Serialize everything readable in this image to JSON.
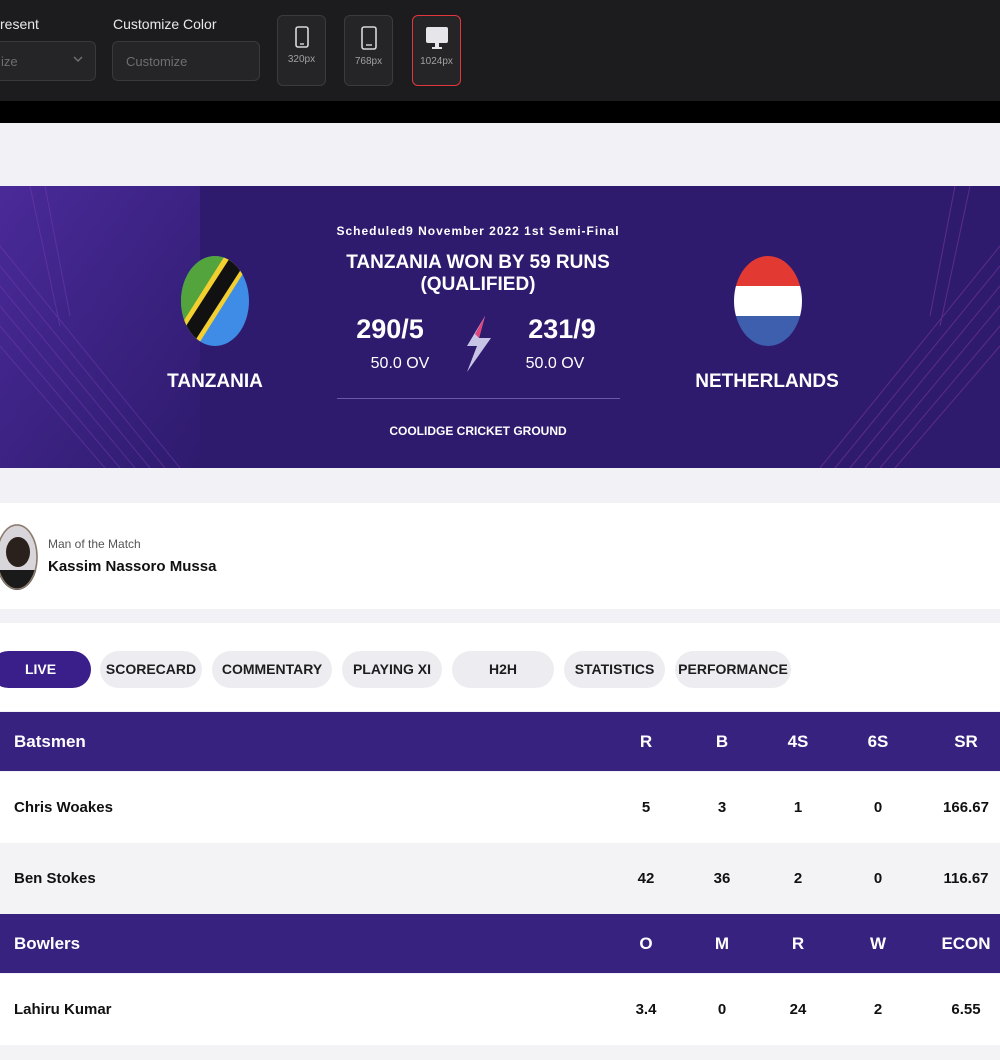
{
  "toolbar": {
    "preset_label": "resent",
    "preset_value": "ize",
    "color_label": "Customize Color",
    "color_placeholder": "Customize",
    "devices": [
      {
        "label": "320px",
        "icon": "phone-icon"
      },
      {
        "label": "768px",
        "icon": "tablet-icon"
      },
      {
        "label": "1024px",
        "icon": "desktop-icon",
        "active": true
      }
    ],
    "accent": "#e2363c"
  },
  "match": {
    "status_line": "Scheduled9 November 2022  1st Semi-Final",
    "result": "TANZANIA WON BY 59 RUNS (QUALIFIED)",
    "venue": "COOLIDGE CRICKET GROUND",
    "team1": {
      "name": "TANZANIA",
      "score": "290/5",
      "overs": "50.0 OV"
    },
    "team2": {
      "name": "NETHERLANDS",
      "score": "231/9",
      "overs": "50.0 OV"
    },
    "brand_color": "#2e1b6e"
  },
  "motm": {
    "label": "Man of the Match",
    "player": "Kassim Nassoro Mussa"
  },
  "tabs": [
    "LIVE",
    "SCORECARD",
    "COMMENTARY",
    "PLAYING XI",
    "H2H",
    "STATISTICS",
    "PERFORMANCE"
  ],
  "batting": {
    "title": "Batsmen",
    "columns": [
      "R",
      "B",
      "4S",
      "6S",
      "SR"
    ],
    "rows": [
      {
        "name": "Chris Woakes",
        "values": [
          "5",
          "3",
          "1",
          "0",
          "166.67"
        ]
      },
      {
        "name": "Ben Stokes",
        "values": [
          "42",
          "36",
          "2",
          "0",
          "116.67"
        ]
      }
    ]
  },
  "bowling": {
    "title": "Bowlers",
    "columns": [
      "O",
      "M",
      "R",
      "W",
      "ECON"
    ],
    "rows": [
      {
        "name": "Lahiru Kumar",
        "values": [
          "3.4",
          "0",
          "24",
          "2",
          "6.55"
        ]
      }
    ]
  }
}
